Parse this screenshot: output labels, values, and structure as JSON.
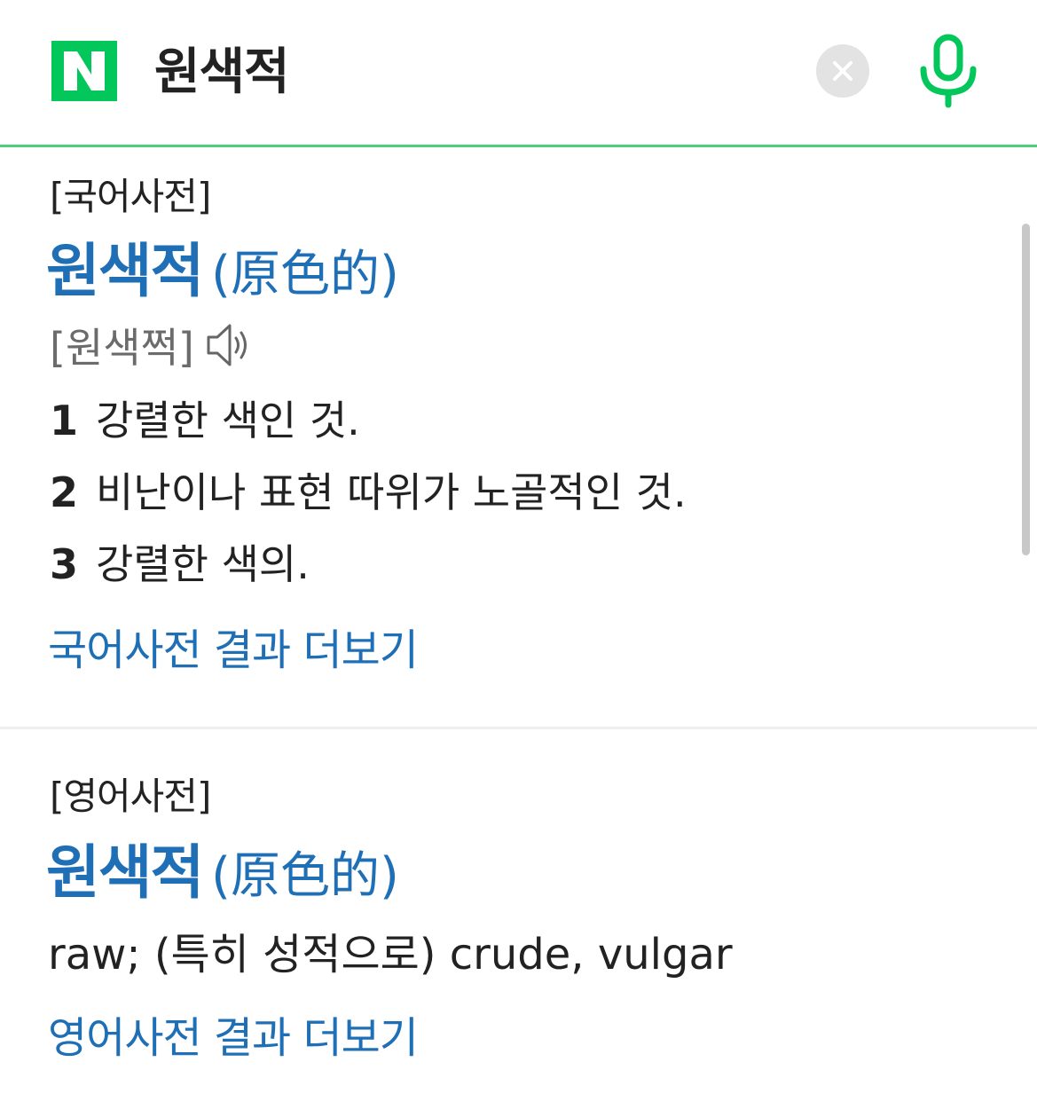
{
  "search": {
    "logo_text": "N",
    "query": "원색적",
    "clear_icon": "close-icon",
    "mic_icon": "microphone-icon"
  },
  "korean_dict": {
    "tag": "[국어사전]",
    "headword": "원색적",
    "hanja": "(原色的)",
    "pronunciation": "[원색쩍]",
    "speaker_icon": "speaker-icon",
    "definitions": [
      {
        "num": "1",
        "text": "강렬한 색인 것."
      },
      {
        "num": "2",
        "text": "비난이나 표현 따위가 노골적인 것."
      },
      {
        "num": "3",
        "text": "강렬한 색의."
      }
    ],
    "more_link": "국어사전 결과 더보기"
  },
  "english_dict": {
    "tag": "[영어사전]",
    "headword": "원색적",
    "hanja": "(原色的)",
    "meaning": "raw; (특히 성적으로) crude, vulgar",
    "more_link": "영어사전 결과 더보기"
  },
  "colors": {
    "brand_green": "#03c75a",
    "link_blue": "#1e6fb6"
  }
}
